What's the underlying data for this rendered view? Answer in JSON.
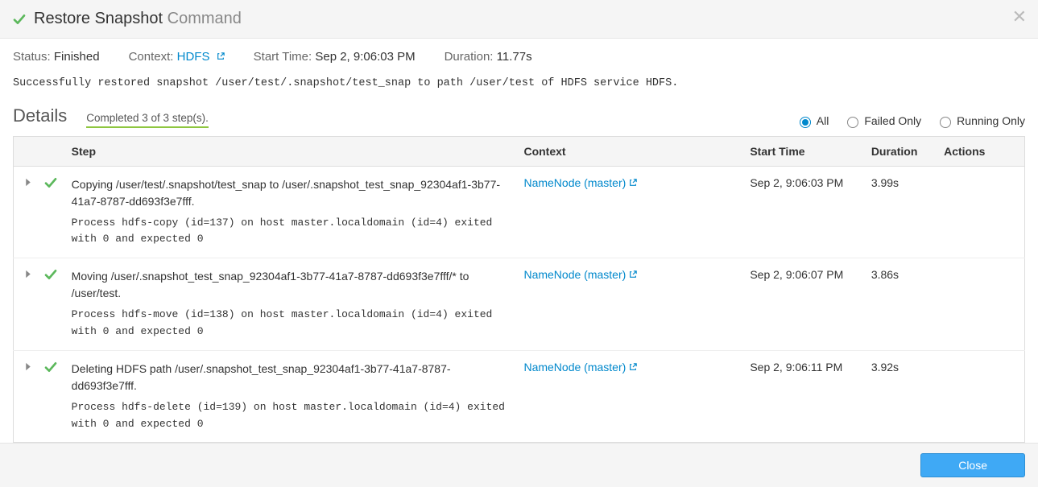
{
  "header": {
    "title_strong": "Restore Snapshot",
    "title_suffix": "Command"
  },
  "summary": {
    "status_label": "Status:",
    "status_value": "Finished",
    "context_label": "Context:",
    "context_value": "HDFS",
    "start_label": "Start Time:",
    "start_value": "Sep 2, 9:06:03 PM",
    "duration_label": "Duration:",
    "duration_value": "11.77s"
  },
  "result_message": "Successfully restored snapshot /user/test/.snapshot/test_snap to path /user/test of HDFS service HDFS.",
  "details": {
    "title": "Details",
    "completed": "Completed 3 of 3 step(s)."
  },
  "filters": {
    "all": "All",
    "failed": "Failed Only",
    "running": "Running Only",
    "selected": "all"
  },
  "columns": {
    "step": "Step",
    "context": "Context",
    "start": "Start Time",
    "duration": "Duration",
    "actions": "Actions"
  },
  "steps": [
    {
      "desc": "Copying /user/test/.snapshot/test_snap to /user/.snapshot_test_snap_92304af1-3b77-41a7-8787-dd693f3e7fff.",
      "proc": "Process hdfs-copy (id=137) on host master.localdomain (id=4) exited with 0 and expected 0",
      "context": "NameNode (master)",
      "start": "Sep 2, 9:06:03 PM",
      "duration": "3.99s"
    },
    {
      "desc": "Moving /user/.snapshot_test_snap_92304af1-3b77-41a7-8787-dd693f3e7fff/* to /user/test.",
      "proc": "Process hdfs-move (id=138) on host master.localdomain (id=4) exited with 0 and expected 0",
      "context": "NameNode (master)",
      "start": "Sep 2, 9:06:07 PM",
      "duration": "3.86s"
    },
    {
      "desc": "Deleting HDFS path /user/.snapshot_test_snap_92304af1-3b77-41a7-8787-dd693f3e7fff.",
      "proc": "Process hdfs-delete (id=139) on host master.localdomain (id=4) exited with 0 and expected 0",
      "context": "NameNode (master)",
      "start": "Sep 2, 9:06:11 PM",
      "duration": "3.92s"
    }
  ],
  "footer": {
    "close": "Close"
  }
}
